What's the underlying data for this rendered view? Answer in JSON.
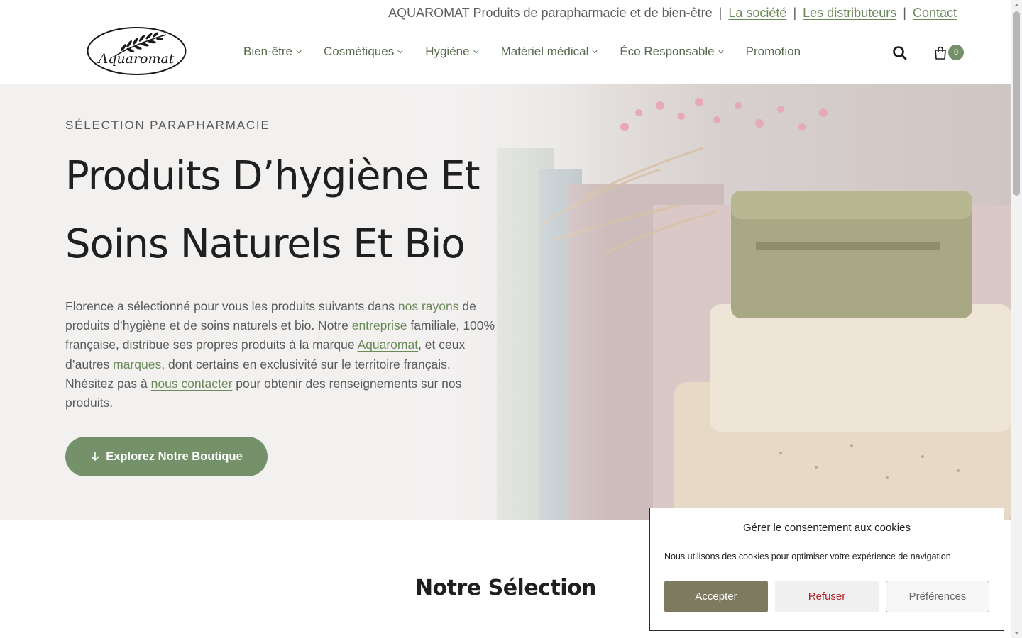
{
  "topbar": {
    "intro": "AQUAROMAT Produits de parapharmacie et de bien-être",
    "separator": "|",
    "links": [
      "La société",
      "Les distributeurs",
      "Contact"
    ]
  },
  "header": {
    "logo_text": "Aquaromat",
    "nav": [
      "Bien-être",
      "Cosmétiques",
      "Hygiène",
      "Matériel médical",
      "Éco Responsable",
      "Promotion"
    ],
    "cart_count": "0"
  },
  "hero": {
    "eyebrow": "SÉLECTION PARAPHARMACIE",
    "title_line1": "Produits D’hygiène Et",
    "title_line2": "Soins Naturels Et Bio",
    "text": {
      "p1": "Florence a sélectionné pour vous les produits suivants dans ",
      "link1": "nos rayons",
      "p2": " de produits d’hygiène et de soins naturels et bio. Notre ",
      "link2": "entreprise",
      "p3": " familiale, 100% française, distribue ses propres produits à la marque ",
      "link3": "Aquaromat",
      "p4": ", et ceux d’autres ",
      "link4": "marques",
      "p5": ", dont certains en exclusivité sur le territoire français. Nhésitez pas à ",
      "link5": "nous contacter",
      "p6": " pour obtenir des renseignements sur nos produits."
    },
    "cta_label": "Explorez Notre Boutique"
  },
  "section": {
    "title": "Notre Sélection"
  },
  "cookie": {
    "title": "Gérer le consentement aux cookies",
    "text": "Nous utilisons des cookies pour optimiser votre expérience de navigation.",
    "accept": "Accepter",
    "refuse": "Refuser",
    "preferences": "Préférences"
  },
  "colors": {
    "accent": "#74916a",
    "link": "#6b8a5a",
    "cookie_accept": "#7d7a5f",
    "cookie_refuse_text": "#b2222a"
  }
}
